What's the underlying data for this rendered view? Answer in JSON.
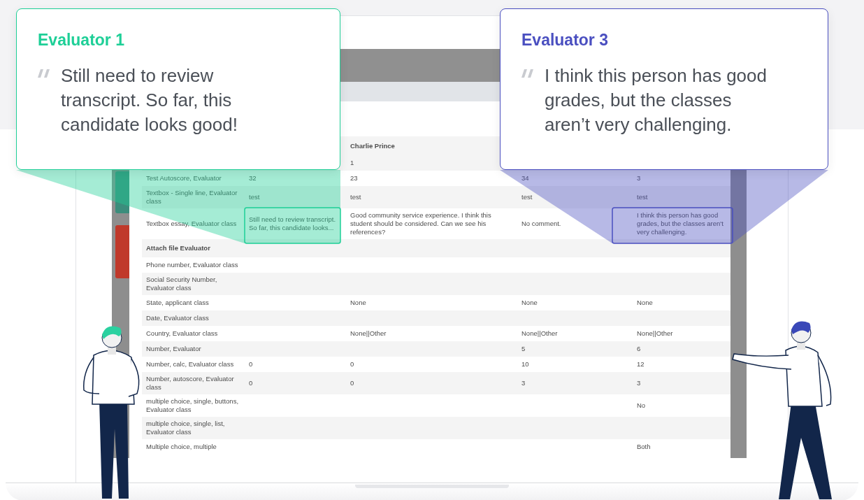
{
  "callouts": [
    {
      "title": "Evaluator 1",
      "quote": "Still need to review transcript. So far, this candidate looks good!",
      "color": "#1ecf97"
    },
    {
      "title": "Evaluator 3",
      "quote": "I think this person has good grades, but the classes aren’t very challenging.",
      "color": "#4a4fc0"
    }
  ],
  "table": {
    "header": {
      "column_3": "Charlie Prince"
    },
    "rows": [
      {
        "kind": "field",
        "column_3": "1"
      },
      {
        "kind": "field",
        "label": "Test Autoscore, Evaluator",
        "column_2": "32",
        "column_3": "23",
        "column_4": "34",
        "column_5": "3"
      },
      {
        "kind": "field",
        "label": "Textbox - Single line, Evaluator class",
        "column_2": "test",
        "column_3": "test",
        "column_4": "test",
        "column_5": "test"
      },
      {
        "kind": "field",
        "label": "Textbox essay, Evaluator class",
        "column_2": "Still need to review transcript. So far, this candidate looks...",
        "column_3": "Good community service experience. I think this student should be considered. Can we see his references?",
        "column_4": "No comment.",
        "column_5": "I think this person has good grades, but the classes aren't very challenging."
      },
      {
        "kind": "section",
        "label": "Attach file Evaluator"
      },
      {
        "kind": "field",
        "label": "Phone number, Evaluator class"
      },
      {
        "kind": "field",
        "label": "Social Security Number, Evaluator class"
      },
      {
        "kind": "field",
        "label": "State, applicant class",
        "column_3": "None",
        "column_4": "None",
        "column_5": "None"
      },
      {
        "kind": "field",
        "label": "Date, Evaluator class"
      },
      {
        "kind": "field",
        "label": "Country, Evaluator class",
        "column_3": "None||Other",
        "column_4": "None||Other",
        "column_5": "None||Other"
      },
      {
        "kind": "field",
        "label": "Number, Evaluator",
        "column_4": "5",
        "column_5": "6"
      },
      {
        "kind": "field",
        "label": "Number, calc, Evaluator class",
        "column_2": "0",
        "column_3": "0",
        "column_4": "10",
        "column_5": "12"
      },
      {
        "kind": "field",
        "label": "Number, autoscore, Evaluator class",
        "column_2": "0",
        "column_3": "0",
        "column_4": "3",
        "column_5": "3"
      },
      {
        "kind": "field",
        "label": "multiple choice, single, buttons, Evaluator class",
        "column_5": "No"
      },
      {
        "kind": "field",
        "label": "multiple choice, single, list, Evaluator class"
      },
      {
        "kind": "field",
        "label": "Multiple choice, multiple",
        "column_5": "Both"
      }
    ]
  }
}
